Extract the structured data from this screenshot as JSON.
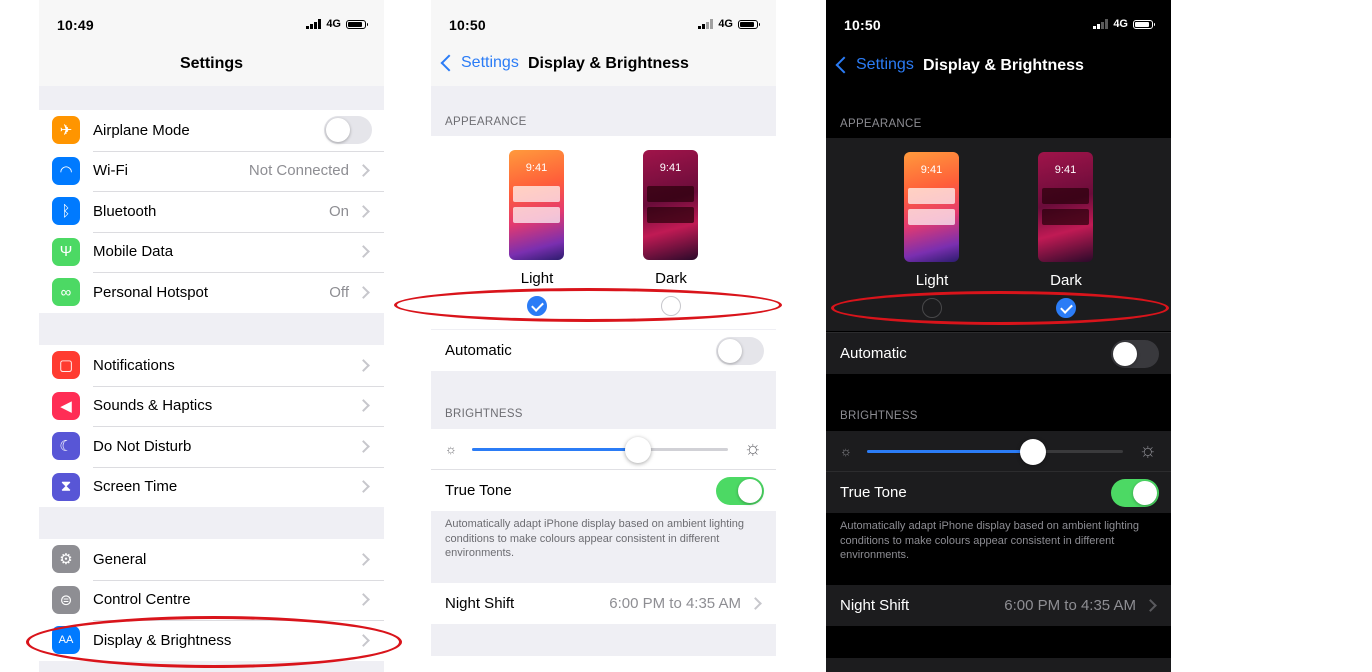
{
  "left_screen": {
    "status": {
      "time": "10:49",
      "network": "4G"
    },
    "title": "Settings",
    "group1": [
      {
        "label": "Airplane Mode",
        "icon": "airplane-icon",
        "color": "#ff9500",
        "toggle": true
      },
      {
        "label": "Wi-Fi",
        "value": "Not Connected",
        "icon": "wifi-icon",
        "color": "#007aff"
      },
      {
        "label": "Bluetooth",
        "value": "On",
        "icon": "bluetooth-icon",
        "color": "#007aff"
      },
      {
        "label": "Mobile Data",
        "icon": "antenna-icon",
        "color": "#4cd964"
      },
      {
        "label": "Personal Hotspot",
        "value": "Off",
        "icon": "hotspot-icon",
        "color": "#4cd964"
      }
    ],
    "group2": [
      {
        "label": "Notifications",
        "icon": "notifications-icon",
        "color": "#ff3b30"
      },
      {
        "label": "Sounds & Haptics",
        "icon": "speaker-icon",
        "color": "#ff2d55"
      },
      {
        "label": "Do Not Disturb",
        "icon": "moon-icon",
        "color": "#5856d6"
      },
      {
        "label": "Screen Time",
        "icon": "hourglass-icon",
        "color": "#5856d6"
      }
    ],
    "group3": [
      {
        "label": "General",
        "icon": "gear-icon",
        "color": "#8e8e93"
      },
      {
        "label": "Control Centre",
        "icon": "switches-icon",
        "color": "#8e8e93"
      },
      {
        "label": "Display & Brightness",
        "icon": "display-aa-icon",
        "color": "#007aff",
        "icon_text": "AA"
      }
    ]
  },
  "middle_screen": {
    "status": {
      "time": "10:50",
      "network": "4G"
    },
    "back_label": "Settings",
    "title": "Display & Brightness",
    "appearance_header": "APPEARANCE",
    "preview_time": "9:41",
    "light_label": "Light",
    "dark_label": "Dark",
    "selected": "light",
    "automatic_label": "Automatic",
    "brightness_header": "BRIGHTNESS",
    "brightness_level": 0.65,
    "true_tone_label": "True Tone",
    "true_tone_desc": "Automatically adapt iPhone display based on ambient lighting conditions to make colours appear consistent in different environments.",
    "night_shift_label": "Night Shift",
    "night_shift_value": "6:00 PM to 4:35 AM"
  },
  "right_screen": {
    "status": {
      "time": "10:50",
      "network": "4G"
    },
    "back_label": "Settings",
    "title": "Display & Brightness",
    "appearance_header": "APPEARANCE",
    "preview_time": "9:41",
    "light_label": "Light",
    "dark_label": "Dark",
    "selected": "dark",
    "automatic_label": "Automatic",
    "brightness_header": "BRIGHTNESS",
    "brightness_level": 0.65,
    "true_tone_label": "True Tone",
    "true_tone_desc": "Automatically adapt iPhone display based on ambient lighting conditions to make colours appear consistent in different environments.",
    "night_shift_label": "Night Shift",
    "night_shift_value": "6:00 PM to 4:35 AM"
  },
  "colors": {
    "accent": "#2b7cf6",
    "annotation": "#d9141b",
    "toggle_on": "#4cd964"
  }
}
